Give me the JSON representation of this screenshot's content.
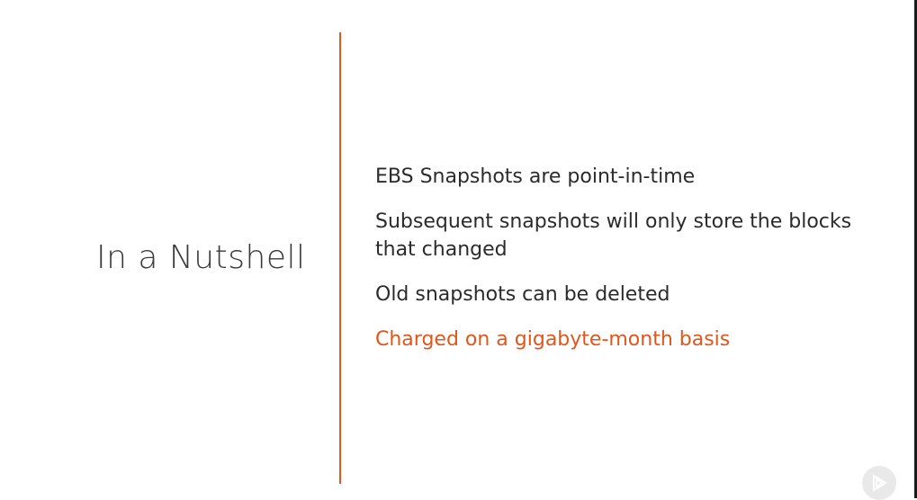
{
  "slide": {
    "title": "In a Nutshell",
    "bullets": [
      {
        "text": "EBS Snapshots are point-in-time",
        "highlight": false
      },
      {
        "text": "Subsequent snapshots will only store the blocks that changed",
        "highlight": false
      },
      {
        "text": "Old snapshots can be deleted",
        "highlight": false
      },
      {
        "text": "Charged on a gigabyte-month basis",
        "highlight": true
      }
    ]
  },
  "colors": {
    "accent": "#e0561b",
    "text": "#2b2b2b",
    "title": "#3a3a3a",
    "background": "#ffffff"
  },
  "icons": {
    "play_badge": "play-logo-icon"
  }
}
